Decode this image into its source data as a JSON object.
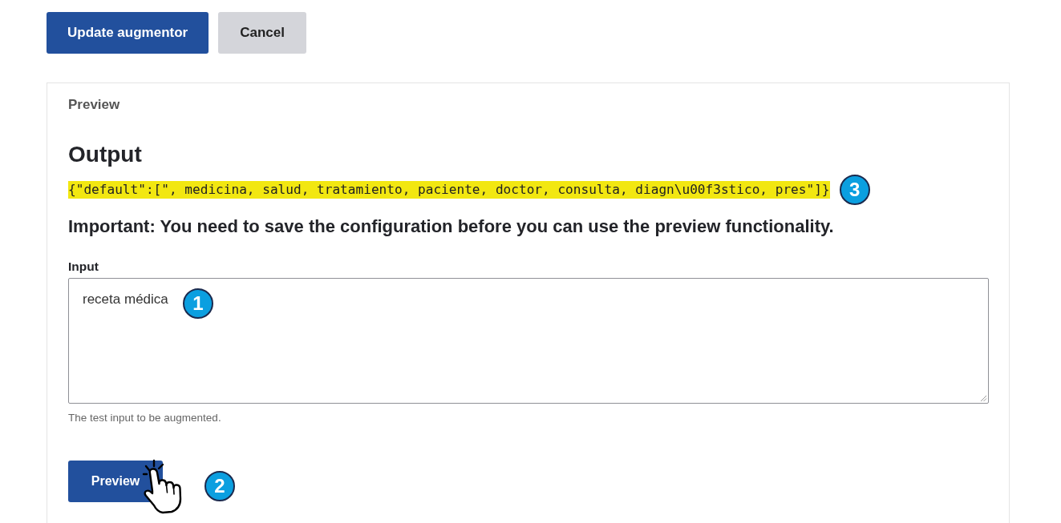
{
  "actions": [
    {
      "label": "Update augmentor",
      "kind": "primary"
    },
    {
      "label": "Cancel",
      "kind": "secondary"
    }
  ],
  "preview": {
    "title": "Preview",
    "output": {
      "heading": "Output",
      "value": "{\"default\":[\", medicina, salud, tratamiento, paciente, doctor, consulta, diagn\\u00f3stico, pres\"]}",
      "callout": "3"
    },
    "notice": "Important: You need to save the configuration before you can use the preview functionality.",
    "input": {
      "label": "Input",
      "value": "receta médica",
      "callout": "1",
      "help": "The test input to be augmented."
    },
    "button": {
      "label": "Preview",
      "callout": "2"
    }
  }
}
